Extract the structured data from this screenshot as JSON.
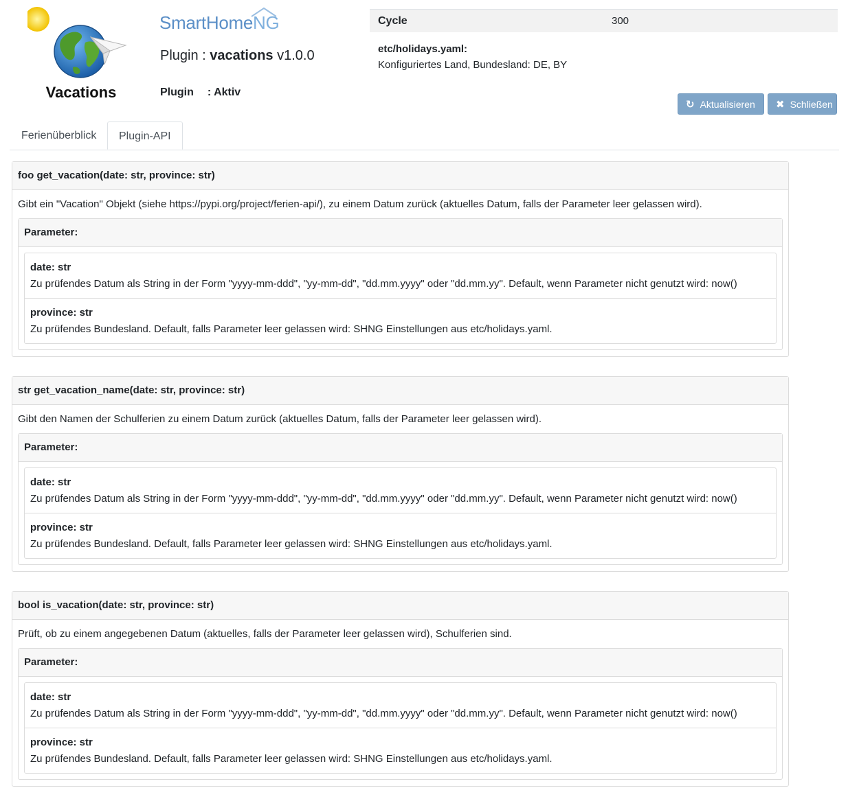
{
  "header": {
    "logo_caption": "Vacations",
    "brand_main": "SmartHome",
    "brand_suffix": "NG",
    "plugin_label": "Plugin : ",
    "plugin_name": "vacations",
    "plugin_version": "v1.0.0",
    "status_label": "Plugin",
    "status_value": ": Aktiv"
  },
  "info": {
    "cycle_label": "Cycle",
    "cycle_value": "300",
    "holidays_label": "etc/holidays.yaml:",
    "holidays_value": "Konfiguriertes Land, Bundesland: DE, BY"
  },
  "buttons": {
    "refresh": "Aktualisieren",
    "close": "Schließen"
  },
  "tabs": [
    {
      "label": "Ferienüberblick",
      "active": false
    },
    {
      "label": "Plugin-API",
      "active": true
    }
  ],
  "api": [
    {
      "signature": "foo get_vacation(date: str, province: str)",
      "description": "Gibt ein \"Vacation\" Objekt (siehe https://pypi.org/project/ferien-api/), zu einem Datum zurück (aktuelles Datum, falls der Parameter leer gelassen wird).",
      "params_label": "Parameter:",
      "params": [
        {
          "name": "date: str",
          "text": "Zu prüfendes Datum als String in der Form \"yyyy-mm-ddd\", \"yy-mm-dd\", \"dd.mm.yyyy\" oder \"dd.mm.yy\". Default, wenn Parameter nicht genutzt wird: now()"
        },
        {
          "name": "province: str",
          "text": "Zu prüfendes Bundesland. Default, falls Parameter leer gelassen wird: SHNG Einstellungen aus etc/holidays.yaml."
        }
      ]
    },
    {
      "signature": "str get_vacation_name(date: str, province: str)",
      "description": "Gibt den Namen der Schulferien zu einem Datum zurück (aktuelles Datum, falls der Parameter leer gelassen wird).",
      "params_label": "Parameter:",
      "params": [
        {
          "name": "date: str",
          "text": "Zu prüfendes Datum als String in der Form \"yyyy-mm-ddd\", \"yy-mm-dd\", \"dd.mm.yyyy\" oder \"dd.mm.yy\". Default, wenn Parameter nicht genutzt wird: now()"
        },
        {
          "name": "province: str",
          "text": "Zu prüfendes Bundesland. Default, falls Parameter leer gelassen wird: SHNG Einstellungen aus etc/holidays.yaml."
        }
      ]
    },
    {
      "signature": "bool is_vacation(date: str, province: str)",
      "description": "Prüft, ob zu einem angegebenen Datum (aktuelles, falls der Parameter leer gelassen wird), Schulferien sind.",
      "params_label": "Parameter:",
      "params": [
        {
          "name": "date: str",
          "text": "Zu prüfendes Datum als String in der Form \"yyyy-mm-ddd\", \"yy-mm-dd\", \"dd.mm.yyyy\" oder \"dd.mm.yy\". Default, wenn Parameter nicht genutzt wird: now()"
        },
        {
          "name": "province: str",
          "text": "Zu prüfendes Bundesland. Default, falls Parameter leer gelassen wird: SHNG Einstellungen aus etc/holidays.yaml."
        }
      ]
    }
  ]
}
